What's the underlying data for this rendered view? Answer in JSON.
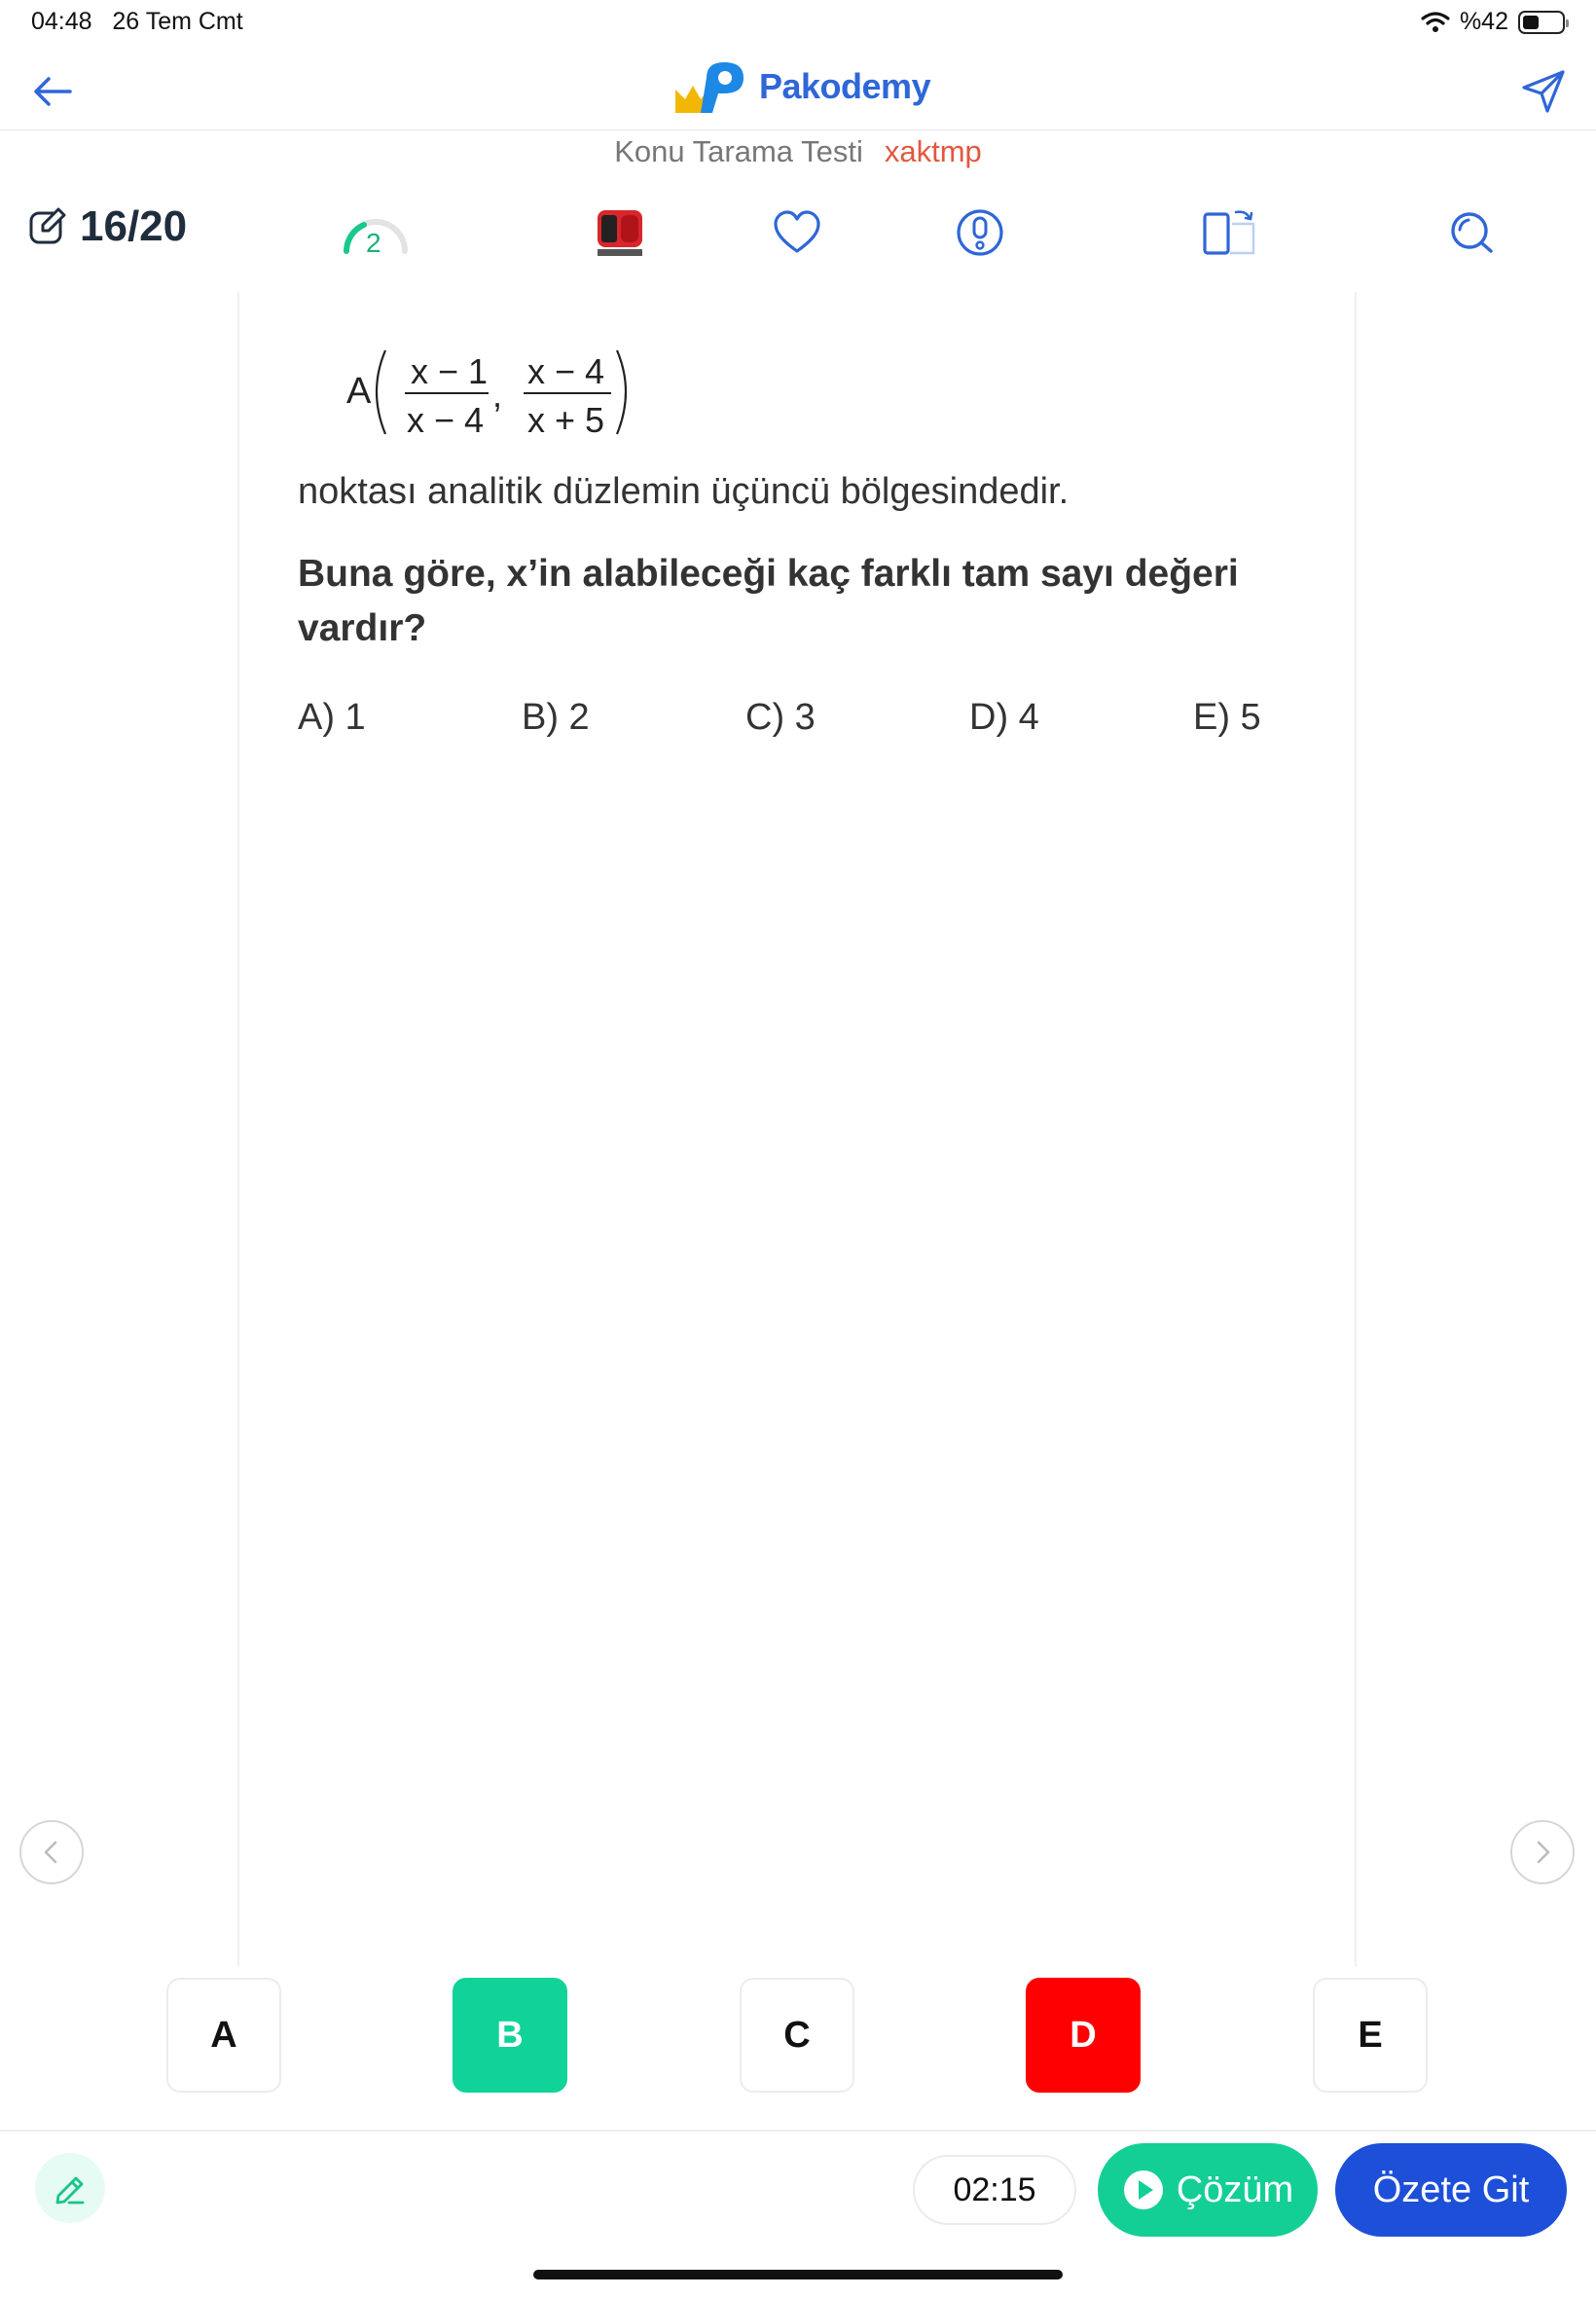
{
  "status": {
    "time": "04:48",
    "date": "26 Tem Cmt",
    "battery": "%42",
    "battery_level": 0.42
  },
  "header": {
    "brand": "Pakodemy",
    "test_name": "Konu Tarama Testi",
    "user_tag": "xaktmp"
  },
  "toolbar": {
    "counter": "16/20",
    "badge": "2"
  },
  "question": {
    "point_label": "A",
    "frac1_num": "x − 1",
    "frac1_den": "x − 4",
    "frac2_num": "x − 4",
    "frac2_den": "x + 5",
    "separator": ",",
    "text": "noktası analitik düzlemin üçüncü bölgesindedir.",
    "prompt": "Buna göre, x’in alabileceği kaç farklı tam sayı değeri vardır?",
    "options": [
      "A) 1",
      "B) 2",
      "C) 3",
      "D) 4",
      "E) 5"
    ]
  },
  "answers": [
    "A",
    "B",
    "C",
    "D",
    "E"
  ],
  "footer": {
    "timer": "02:15",
    "solution": "Çözüm",
    "summary": "Özete Git"
  },
  "colors": {
    "correct": "#10d39a",
    "wrong": "#ff0000",
    "primary": "#1d4fd8",
    "accent": "#14cf95"
  }
}
